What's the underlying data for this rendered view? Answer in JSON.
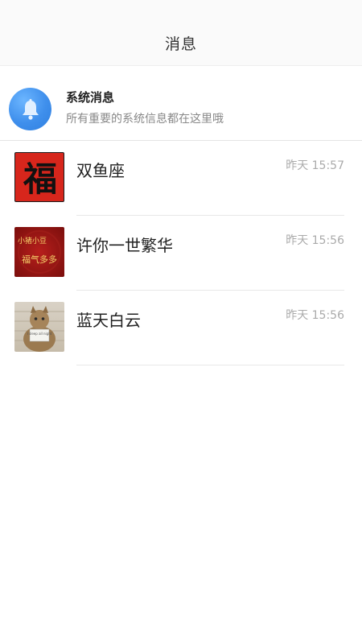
{
  "header": {
    "title": "消息"
  },
  "system_message": {
    "title": "系统消息",
    "description": "所有重要的系统信息都在这里哦",
    "icon": "bell-icon"
  },
  "chats": [
    {
      "name": "双鱼座",
      "time": "昨天 15:57",
      "avatar_text": "福"
    },
    {
      "name": "许你一世繁华",
      "time": "昨天 15:56",
      "avatar_text_top": "小猪小豆",
      "avatar_text_bottom": "福气多多"
    },
    {
      "name": "蓝天白云",
      "time": "昨天 15:56",
      "avatar_sign": "I sleep all night"
    }
  ]
}
